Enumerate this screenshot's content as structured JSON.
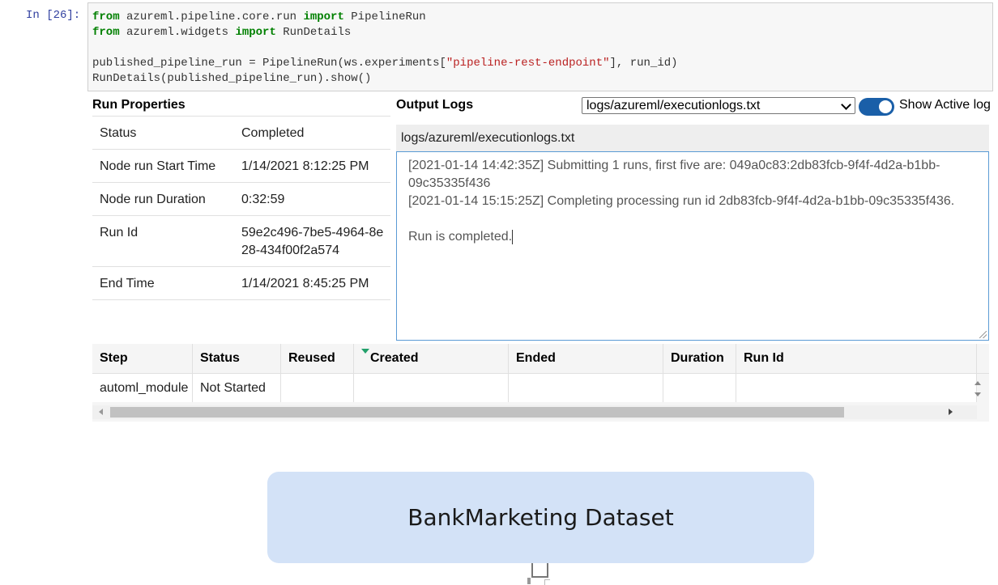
{
  "cell": {
    "prompt": "In [26]:",
    "code": [
      [
        {
          "t": "from",
          "c": "kw"
        },
        {
          "t": " azureml.pipeline.core.run "
        },
        {
          "t": "import",
          "c": "kw"
        },
        {
          "t": " PipelineRun"
        }
      ],
      [
        {
          "t": "from",
          "c": "kw"
        },
        {
          "t": " azureml.widgets "
        },
        {
          "t": "import",
          "c": "kw"
        },
        {
          "t": " RunDetails"
        }
      ],
      [],
      [
        {
          "t": "published_pipeline_run = PipelineRun(ws.experiments["
        },
        {
          "t": "\"pipeline-rest-endpoint\"",
          "c": "str"
        },
        {
          "t": "], run_id)"
        }
      ],
      [
        {
          "t": "RunDetails(published_pipeline_run).show()"
        }
      ]
    ]
  },
  "run_properties": {
    "title": "Run Properties",
    "rows": [
      {
        "key": "Status",
        "value": "Completed"
      },
      {
        "key": "Node run Start Time",
        "value": "1/14/2021 8:12:25 PM"
      },
      {
        "key": "Node run Duration",
        "value": "0:32:59"
      },
      {
        "key": "Run Id",
        "value": "59e2c496-7be5-4964-8e28-434f00f2a574"
      },
      {
        "key": "End Time",
        "value": "1/14/2021 8:45:25 PM"
      }
    ]
  },
  "output_logs": {
    "title": "Output Logs",
    "selected_log": "logs/azureml/executionlogs.txt",
    "toggle_label": "Show Active log",
    "toggle_on": true,
    "header": "logs/azureml/executionlogs.txt",
    "lines": [
      "[2021-01-14 14:42:35Z] Submitting 1 runs, first five are: 049a0c83:2db83fcb-9f4f-4d2a-b1bb-09c35335f436",
      "[2021-01-14 15:15:25Z] Completing processing run id 2db83fcb-9f4f-4d2a-b1bb-09c35335f436.",
      "",
      "Run is completed."
    ]
  },
  "steps_table": {
    "columns": [
      "Step",
      "Status",
      "Reused",
      "Created",
      "Ended",
      "Duration",
      "Run Id"
    ],
    "sorted_column": "Created",
    "rows": [
      [
        "automl_module",
        "Not Started",
        "",
        "",
        "",
        "",
        ""
      ]
    ]
  },
  "graph": {
    "node_label": "BankMarketing Dataset",
    "node_color": "#d3e2f7"
  },
  "colors": {
    "toggle": "#1a5fa8",
    "sort_indicator": "#22a06b",
    "log_border": "#5b9bd5"
  }
}
